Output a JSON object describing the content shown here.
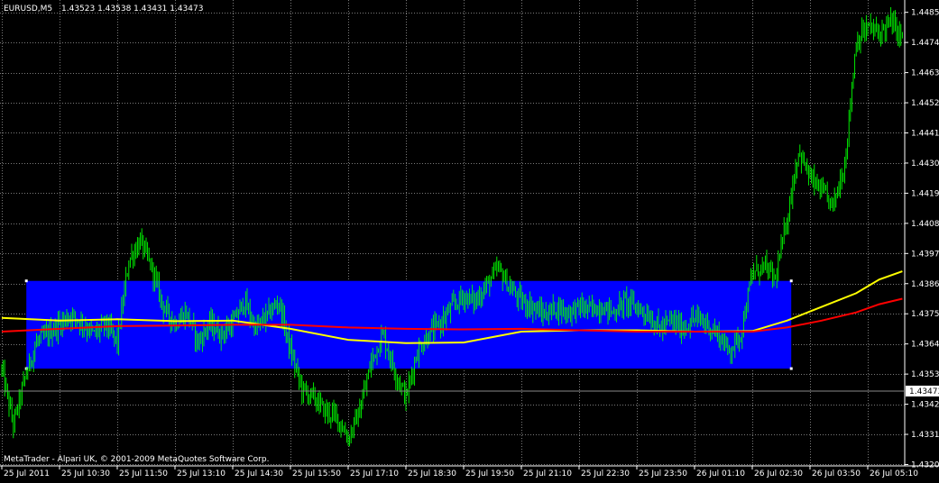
{
  "header": {
    "symbol": "EURUSD,M5",
    "ohlc": "1.43523 1.43538 1.43431 1.43473"
  },
  "footer": {
    "copyright": "MetaTrader - Alpari UK, © 2001-2009 MetaQuotes Software Corp."
  },
  "colors": {
    "background": "#000000",
    "grid": "#7a7a7a",
    "bull": "#00ff00",
    "bear": "#00ff00",
    "ma_fast": "#ffff00",
    "ma_slow": "#ff0000",
    "range_box": "#0000ff",
    "price_label_bg": "#ffffff"
  },
  "chart_data": {
    "type": "candlestick",
    "symbol": "EURUSD",
    "timeframe": "M5",
    "ylim": [
      1.432,
      1.449
    ],
    "y_ticks": [
      1.44855,
      1.44745,
      1.44635,
      1.44525,
      1.44415,
      1.44305,
      1.44195,
      1.44085,
      1.43975,
      1.43865,
      1.43755,
      1.43645,
      1.43535,
      1.43425,
      1.43315,
      1.43205
    ],
    "y_tick_labels": [
      "1.44855",
      "1.44745",
      "1.44635",
      "1.44525",
      "1.44415",
      "1.44305",
      "1.44195",
      "1.44085",
      "1.43975",
      "1.43865",
      "1.43755",
      "1.43645",
      "1.43535",
      "1.43425",
      "1.43315",
      "1.43205"
    ],
    "x_tick_labels": [
      "25 Jul 2011",
      "25 Jul 10:30",
      "25 Jul 11:50",
      "25 Jul 13:10",
      "25 Jul 14:30",
      "25 Jul 15:50",
      "25 Jul 17:10",
      "25 Jul 18:30",
      "25 Jul 19:50",
      "25 Jul 21:10",
      "25 Jul 22:30",
      "25 Jul 23:50",
      "26 Jul 01:10",
      "26 Jul 02:30",
      "26 Jul 03:50",
      "26 Jul 05:10"
    ],
    "current_price": 1.43473,
    "current_price_label": "1.43473",
    "close_path": [
      [
        0,
        1.4355
      ],
      [
        8,
        1.4335
      ],
      [
        16,
        1.4352
      ],
      [
        24,
        1.4365
      ],
      [
        32,
        1.4368
      ],
      [
        40,
        1.4372
      ],
      [
        48,
        1.4375
      ],
      [
        56,
        1.4372
      ],
      [
        64,
        1.4368
      ],
      [
        72,
        1.4372
      ],
      [
        80,
        1.4365
      ],
      [
        88,
        1.4395
      ],
      [
        96,
        1.4402
      ],
      [
        104,
        1.4392
      ],
      [
        112,
        1.4378
      ],
      [
        120,
        1.4372
      ],
      [
        128,
        1.4376
      ],
      [
        136,
        1.4365
      ],
      [
        144,
        1.4372
      ],
      [
        152,
        1.4368
      ],
      [
        160,
        1.4372
      ],
      [
        168,
        1.438
      ],
      [
        176,
        1.437
      ],
      [
        184,
        1.4375
      ],
      [
        192,
        1.438
      ],
      [
        200,
        1.4362
      ],
      [
        208,
        1.4348
      ],
      [
        216,
        1.4345
      ],
      [
        224,
        1.434
      ],
      [
        232,
        1.4338
      ],
      [
        240,
        1.433
      ],
      [
        248,
        1.434
      ],
      [
        256,
        1.4358
      ],
      [
        264,
        1.4368
      ],
      [
        272,
        1.4355
      ],
      [
        280,
        1.4345
      ],
      [
        288,
        1.4362
      ],
      [
        296,
        1.4368
      ],
      [
        304,
        1.4372
      ],
      [
        312,
        1.4378
      ],
      [
        320,
        1.4382
      ],
      [
        328,
        1.438
      ],
      [
        336,
        1.4386
      ],
      [
        344,
        1.4392
      ],
      [
        352,
        1.4385
      ],
      [
        360,
        1.438
      ],
      [
        368,
        1.4378
      ],
      [
        376,
        1.4375
      ],
      [
        384,
        1.4378
      ],
      [
        392,
        1.4376
      ],
      [
        400,
        1.4378
      ],
      [
        408,
        1.4377
      ],
      [
        416,
        1.4378
      ],
      [
        424,
        1.4376
      ],
      [
        432,
        1.438
      ],
      [
        440,
        1.4378
      ],
      [
        448,
        1.4375
      ],
      [
        456,
        1.437
      ],
      [
        464,
        1.4373
      ],
      [
        472,
        1.437
      ],
      [
        480,
        1.4374
      ],
      [
        488,
        1.4372
      ],
      [
        496,
        1.4368
      ],
      [
        504,
        1.4362
      ],
      [
        512,
        1.4368
      ],
      [
        520,
        1.439
      ],
      [
        528,
        1.4393
      ],
      [
        536,
        1.4388
      ],
      [
        544,
        1.441
      ],
      [
        552,
        1.4435
      ],
      [
        560,
        1.4425
      ],
      [
        568,
        1.442
      ],
      [
        576,
        1.4415
      ],
      [
        584,
        1.443
      ],
      [
        592,
        1.4475
      ],
      [
        600,
        1.448
      ],
      [
        608,
        1.4478
      ],
      [
        616,
        1.4482
      ],
      [
        624,
        1.4476
      ]
    ],
    "series": [
      {
        "points": [
          [
            0,
            1.4374
          ],
          [
            40,
            1.4373
          ],
          [
            80,
            1.43735
          ],
          [
            120,
            1.43728
          ],
          [
            160,
            1.4373
          ],
          [
            200,
            1.437
          ],
          [
            240,
            1.4366
          ],
          [
            280,
            1.43648
          ],
          [
            320,
            1.4365
          ],
          [
            360,
            1.4369
          ],
          [
            400,
            1.43695
          ],
          [
            440,
            1.43695
          ],
          [
            480,
            1.4369
          ],
          [
            520,
            1.43692
          ],
          [
            544,
            1.4373
          ],
          [
            568,
            1.4378
          ],
          [
            592,
            1.4383
          ],
          [
            608,
            1.4388
          ],
          [
            624,
            1.4391
          ]
        ]
      },
      {
        "points": [
          [
            0,
            1.4369
          ],
          [
            40,
            1.437
          ],
          [
            80,
            1.4371
          ],
          [
            120,
            1.43712
          ],
          [
            160,
            1.43715
          ],
          [
            200,
            1.43715
          ],
          [
            240,
            1.43705
          ],
          [
            280,
            1.437
          ],
          [
            320,
            1.43698
          ],
          [
            360,
            1.437
          ],
          [
            400,
            1.43695
          ],
          [
            440,
            1.4369
          ],
          [
            480,
            1.4369
          ],
          [
            520,
            1.4369
          ],
          [
            544,
            1.43705
          ],
          [
            568,
            1.4373
          ],
          [
            592,
            1.4376
          ],
          [
            608,
            1.4379
          ],
          [
            624,
            1.4381
          ]
        ]
      }
    ],
    "range_box": {
      "start_bar": 17,
      "end_bar": 547,
      "top": 1.43875,
      "bottom": 1.43555
    }
  }
}
